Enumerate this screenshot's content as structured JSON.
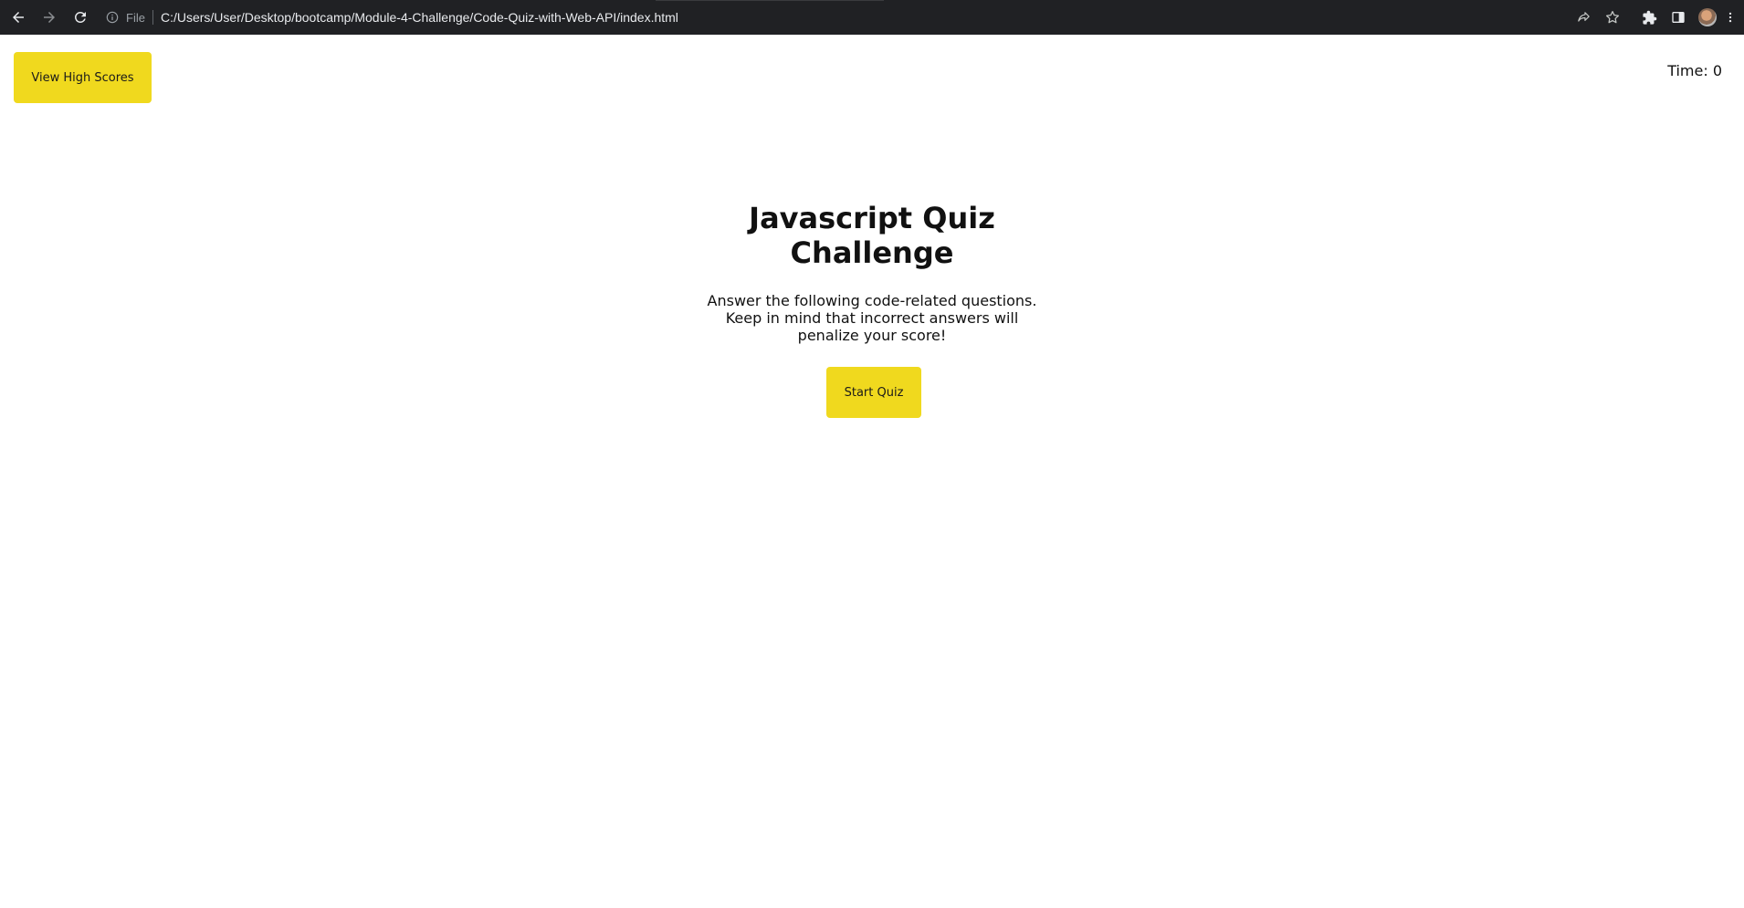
{
  "browser": {
    "file_label": "File",
    "url": "C:/Users/User/Desktop/bootcamp/Module-4-Challenge/Code-Quiz-with-Web-API/index.html",
    "icons": [
      "back-arrow-icon",
      "forward-arrow-icon",
      "reload-icon",
      "info-icon",
      "share-icon",
      "star-icon",
      "extensions-icon",
      "side-panel-icon",
      "profile-avatar",
      "kebab-menu-icon"
    ]
  },
  "header": {
    "high_scores_label": "View High Scores",
    "timer_text": "Time: 0"
  },
  "quiz": {
    "title": "Javascript Quiz Challenge",
    "description": "Answer the following code-related questions. Keep in mind that incorrect answers will penalize your score!",
    "start_label": "Start Quiz"
  },
  "colors": {
    "accent": "#f0d91e",
    "browser_bar": "#202124",
    "background": "#ffffff"
  }
}
